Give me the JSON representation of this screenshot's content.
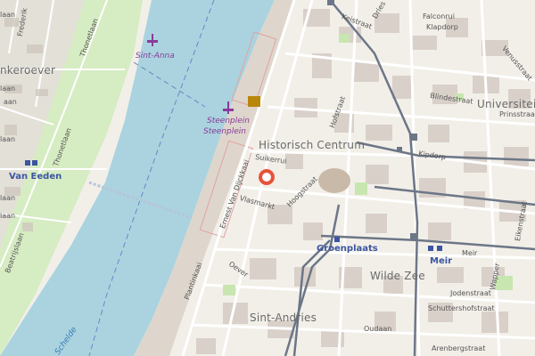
{
  "map": {
    "districts": {
      "historisch_centrum": "Historisch Centrum",
      "sint_andries": "Sint-Andries",
      "wilde_zee": "Wilde Zee",
      "universiteit": "Universiteits",
      "linkeroever": "nkeroever"
    },
    "stations": {
      "van_eeden": "Van Eeden",
      "groenplaats": "Groenplaats",
      "meir": "Meir"
    },
    "pois": {
      "sint_anna": "Sint-Anna",
      "steenplein_1": "Steenplein",
      "steenplein_2": "Steenplein"
    },
    "water": {
      "schelde": "Schelde"
    },
    "streets": {
      "thonetlaan_1": "Thonetlaan",
      "thonetlaan_2": "Thonetlaan",
      "beatrijslaan": "Beatrijslaan",
      "frederik": "Frederik",
      "ernest_van_dijckkaai": "Ernest Van Dijckkaai",
      "plantinkaai": "Plantinkaai",
      "suikerrui": "Suikerrui",
      "hoogstraat": "Hoogstraat",
      "vlasmarkt": "Vlasmarkt",
      "oever": "Oever",
      "kelstraat": "Keistraat",
      "drie": "Dries",
      "falconrui": "Falconrui",
      "klapdorp": "Klapdorp",
      "blindestraat": "Blindestraat",
      "prinsstraat": "Prinsstraat",
      "kipdorp": "Kipdorp",
      "hofstraat": "Hofstraat",
      "meir_street": "Meir",
      "jodenstraat": "Jodenstraat",
      "schuttershofstraat": "Schuttershofstraat",
      "arenbergstraat": "Arenbergstraat",
      "oudaan": "Oudaan",
      "wapper": "Wapper",
      "eikenstraat": "Eikenstraat",
      "venusstraat": "Venusstraat",
      "laan_1": "laan",
      "laan_2": "laan",
      "laan_3": "laan",
      "laan_4": "laan",
      "laan_5": "laan",
      "aan": "aan"
    },
    "colors": {
      "background": "#f2efe9",
      "water": "#aad3df",
      "park": "#c8e6b0",
      "building": "#d9d0c9",
      "road": "#ffffff",
      "tram": "#6c7687",
      "marker": "#e5533a",
      "station": "#3b55a0",
      "poi": "#8a3b9a"
    }
  }
}
